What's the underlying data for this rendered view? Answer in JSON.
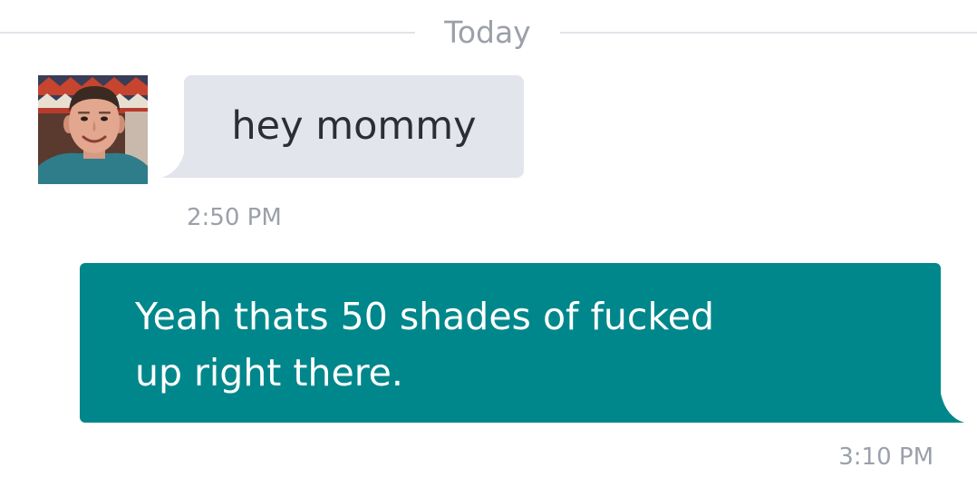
{
  "divider": {
    "label": "Today"
  },
  "messages": [
    {
      "direction": "incoming",
      "text": "hey mommy",
      "time": "2:50 PM",
      "has_avatar": true
    },
    {
      "direction": "outgoing",
      "text": "Yeah thats 50 shades of fucked up right there.",
      "time": "3:10 PM"
    }
  ],
  "colors": {
    "incoming_bubble": "#e2e5ec",
    "outgoing_bubble": "#00878b",
    "timestamp": "#9ba0a9",
    "divider_line": "#e1e3e8"
  }
}
